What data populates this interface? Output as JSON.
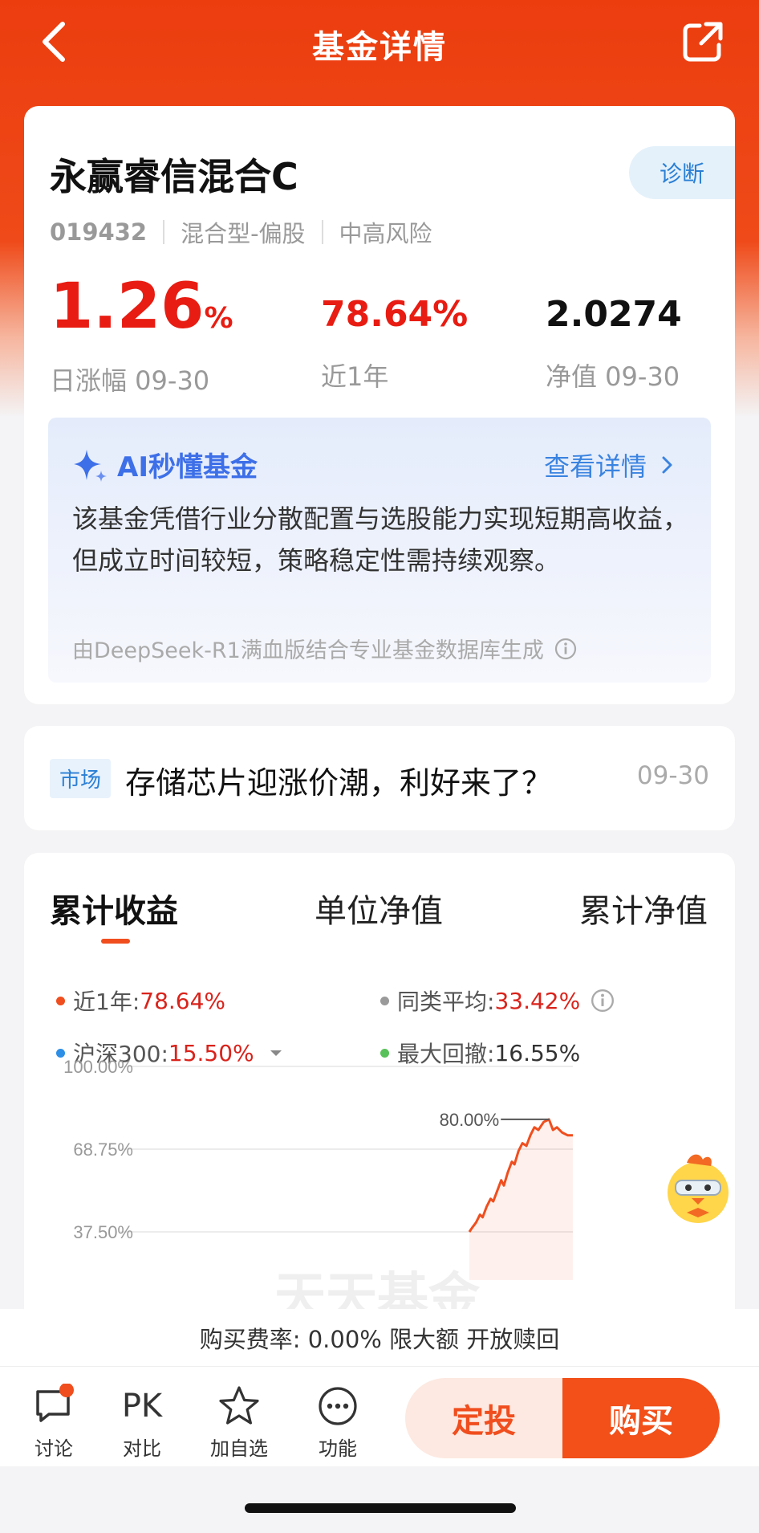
{
  "nav": {
    "title": "基金详情"
  },
  "fund": {
    "name": "永赢睿信混合C",
    "diagnose_label": "诊断",
    "code": "019432",
    "type": "混合型-偏股",
    "risk": "中高风险",
    "daily_change_value": "1.26",
    "daily_change_unit": "%",
    "daily_change_label": "日涨幅 09-30",
    "year_return": "78.64%",
    "year_return_label": "近1年",
    "nav_value": "2.0274",
    "nav_label": "净值 09-30"
  },
  "ai": {
    "title": "AI秒懂基金",
    "detail_link": "查看详情",
    "summary": "该基金凭借行业分散配置与选股能力实现短期高收益，但成立时间较短，策略稳定性需持续观察。",
    "source": "由DeepSeek-R1满血版结合专业基金数据库生成"
  },
  "news": {
    "tag": "市场",
    "headline": "存储芯片迎涨价潮，利好来了？",
    "date": "09-30"
  },
  "chart_tabs": [
    "累计收益",
    "单位净值",
    "累计净值"
  ],
  "legend": {
    "fund_label": "近1年:",
    "fund_value": "78.64%",
    "peer_label": "同类平均:",
    "peer_value": "33.42%",
    "index_label": "沪深300:",
    "index_value": "15.50%",
    "drawdown_label": "最大回撤:",
    "drawdown_value": "16.55%"
  },
  "colors": {
    "brand": "#ec3d0f",
    "fund_line": "#f04e1e",
    "peer": "#9a9a9a",
    "index": "#2d8fe6",
    "drawdown": "#59c15a"
  },
  "chart_data": {
    "type": "line",
    "y_tick_labels": [
      "100.00%",
      "68.75%",
      "37.50%"
    ],
    "ylim": [
      37.5,
      100
    ],
    "series": [
      {
        "name": "近1年",
        "points": [
          [
            0.0,
            37.5
          ],
          [
            0.02,
            39
          ],
          [
            0.05,
            41
          ],
          [
            0.08,
            44
          ],
          [
            0.1,
            43
          ],
          [
            0.13,
            47
          ],
          [
            0.16,
            50
          ],
          [
            0.18,
            49
          ],
          [
            0.21,
            53
          ],
          [
            0.24,
            57
          ],
          [
            0.26,
            55
          ],
          [
            0.29,
            60
          ],
          [
            0.32,
            64
          ],
          [
            0.34,
            63
          ],
          [
            0.37,
            68
          ],
          [
            0.4,
            71
          ],
          [
            0.43,
            70
          ],
          [
            0.46,
            74
          ],
          [
            0.49,
            77
          ],
          [
            0.52,
            76
          ],
          [
            0.56,
            79
          ],
          [
            0.6,
            80
          ],
          [
            0.63,
            76
          ],
          [
            0.66,
            77
          ],
          [
            0.7,
            75
          ],
          [
            0.74,
            74
          ],
          [
            0.78,
            74
          ]
        ]
      }
    ],
    "annotation": "80.00%",
    "watermark": "天天基金"
  },
  "footer": {
    "fee_text": "购买费率: 0.00% 限大额 开放赎回",
    "items": [
      "讨论",
      "对比",
      "加自选",
      "功能"
    ],
    "pk_text": "PK",
    "btn_dingtou": "定投",
    "btn_buy": "购买"
  }
}
